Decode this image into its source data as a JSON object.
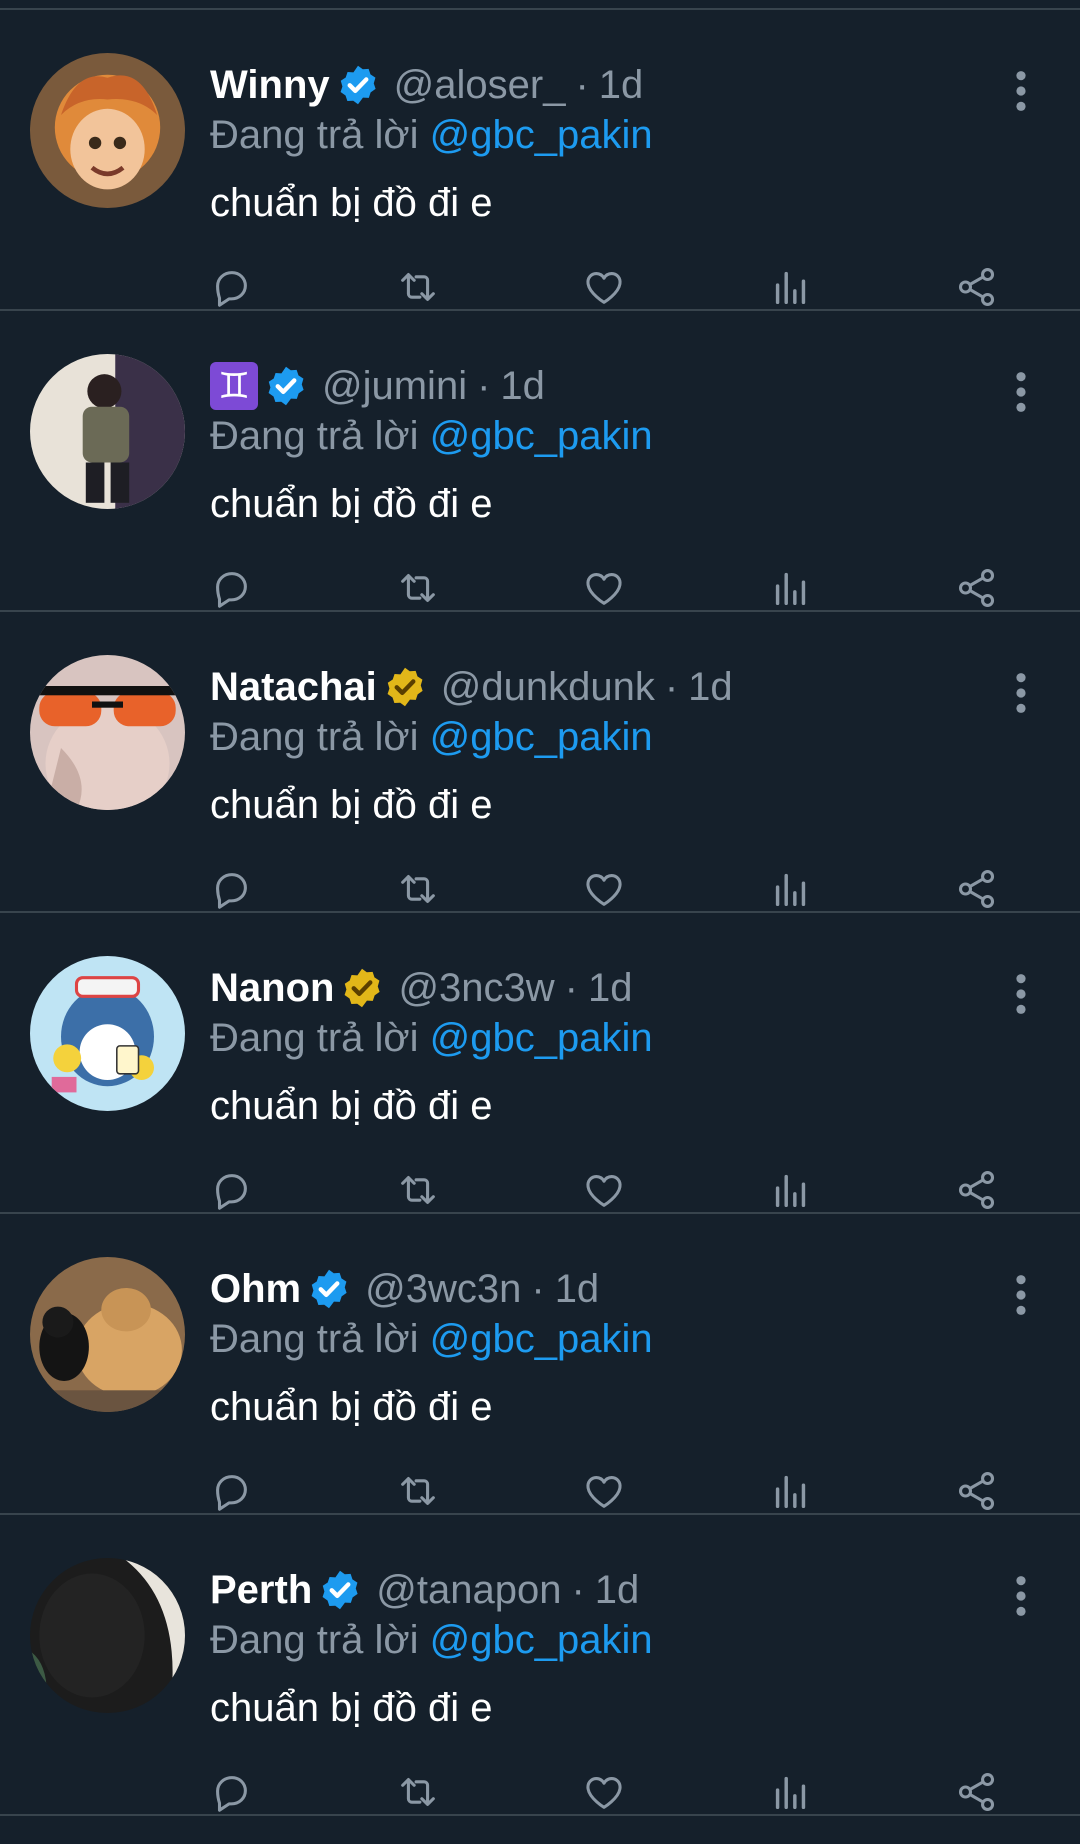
{
  "feed": {
    "replies": [
      {
        "name": "Winny",
        "badge": "blue-verified-badge",
        "handle": "@aloser_",
        "time": "1d",
        "reply_prefix": "Đang trả lời",
        "reply_to": "@gbc_pakin",
        "text": "chuẩn bị đồ đi e"
      },
      {
        "name": "",
        "name_emoji": "♊",
        "badge": "blue-verified-badge",
        "handle": "@jumini",
        "time": "1d",
        "reply_prefix": "Đang trả lời",
        "reply_to": "@gbc_pakin",
        "text": "chuẩn bị đồ đi e"
      },
      {
        "name": "Natachai",
        "badge": "gold-verified-badge",
        "handle": "@dunkdunk",
        "time": "1d",
        "reply_prefix": "Đang trả lời",
        "reply_to": "@gbc_pakin",
        "text": "chuẩn bị đồ đi e"
      },
      {
        "name": "Nanon",
        "badge": "gold-verified-badge",
        "handle": "@3nc3w",
        "time": "1d",
        "reply_prefix": "Đang trả lời",
        "reply_to": "@gbc_pakin",
        "text": "chuẩn bị đồ đi e"
      },
      {
        "name": "Ohm",
        "badge": "blue-verified-badge",
        "handle": "@3wc3n",
        "time": "1d",
        "reply_prefix": "Đang trả lời",
        "reply_to": "@gbc_pakin",
        "text": "chuẩn bị đồ đi e"
      },
      {
        "name": "Perth",
        "badge": "blue-verified-badge",
        "handle": "@tanapon",
        "time": "1d",
        "reply_prefix": "Đang trả lời",
        "reply_to": "@gbc_pakin",
        "text": "chuẩn bị đồ đi e"
      }
    ],
    "separator": "·",
    "actions": [
      "reply-icon",
      "retweet-icon",
      "like-icon",
      "views-icon",
      "share-icon"
    ]
  },
  "colors": {
    "background": "#15202b",
    "divider": "#38444d",
    "secondary_text": "#8b98a5",
    "link": "#1d9bf0",
    "blue_badge": "#1d9bf0",
    "gold_badge": "#e2b719",
    "icon": "#8b98a5"
  }
}
